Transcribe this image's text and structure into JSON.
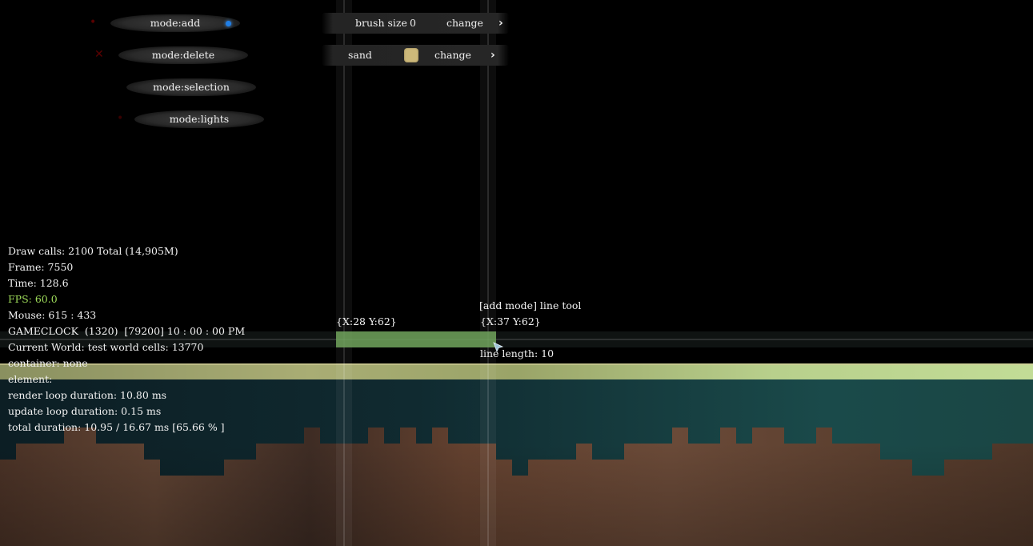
{
  "mode_menu": {
    "items": [
      {
        "label": "mode:add",
        "active": true
      },
      {
        "label": "mode:delete",
        "active": false
      },
      {
        "label": "mode:selection",
        "active": false
      },
      {
        "label": "mode:lights",
        "active": false
      }
    ]
  },
  "toolbar": {
    "brush_label": "brush size",
    "brush_value": "0",
    "brush_change": "change",
    "element_label": "sand",
    "element_color": "#cdb97a",
    "element_change": "change"
  },
  "debug": {
    "lines": [
      "Draw calls: 2100 Total (14,905M)",
      "Frame: 7550",
      "Time: 128.6",
      "FPS: 60.0",
      "Mouse: 615 : 433",
      "GAMECLOCK  (1320)  [79200] 10 : 00 : 00 PM",
      "Current World: test world cells: 13770",
      "container: none",
      "element:",
      "render loop duration: 10.80 ms",
      "update loop duration: 0.15 ms",
      "total duration: 10.95 / 16.67 ms [65.66 % ]"
    ],
    "fps_color": "#9fdc5a"
  },
  "line_tool": {
    "start_coord": "{X:28 Y:62}",
    "title": "[add mode] line tool",
    "end_coord": "{X:37 Y:62}",
    "length": "line length: 10",
    "line_color": "#6fa25a"
  },
  "colors": {
    "sand_layer": "#a8b878",
    "water": "#14323a",
    "dirt": "#5a3e2e",
    "dirt_dark": "#3c2a22"
  }
}
